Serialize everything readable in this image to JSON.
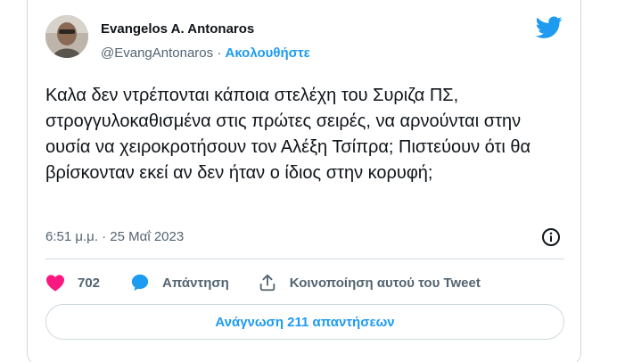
{
  "author": {
    "name": "Evangelos A. Antonaros",
    "handle": "@EvangAntonaros",
    "separator": "·",
    "follow_label": "Ακολουθήστε"
  },
  "tweet": {
    "text": "Καλα δεν ντρέπονται κάποια στελέχη του Συριζα ΠΣ, στρογγυλοκαθισμένα στις πρώτες σειρές, να αρνούνται στην ουσία να χειροκροτήσουν τον Αλέξη Τσίπρα; Πιστεύουν ότι θα βρίσκονταν εκεί αν δεν ήταν ο ίδιος στην κορυφή;",
    "timestamp": "6:51 μ.μ. · 25 Μαΐ 2023"
  },
  "actions": {
    "like_count": "702",
    "reply_label": "Απάντηση",
    "share_label": "Κοινοποίηση αυτού του Tweet"
  },
  "footer": {
    "read_replies_label": "Ανάγνωση 211 απαντήσεων"
  },
  "colors": {
    "twitter_blue": "#1d9bf0",
    "like_pink": "#f91880",
    "text": "#0f1419",
    "secondary_text": "#536471",
    "border": "#cfd9de"
  },
  "icons": [
    "twitter-bird-icon",
    "info-icon",
    "heart-icon",
    "reply-bubble-icon",
    "share-icon"
  ]
}
